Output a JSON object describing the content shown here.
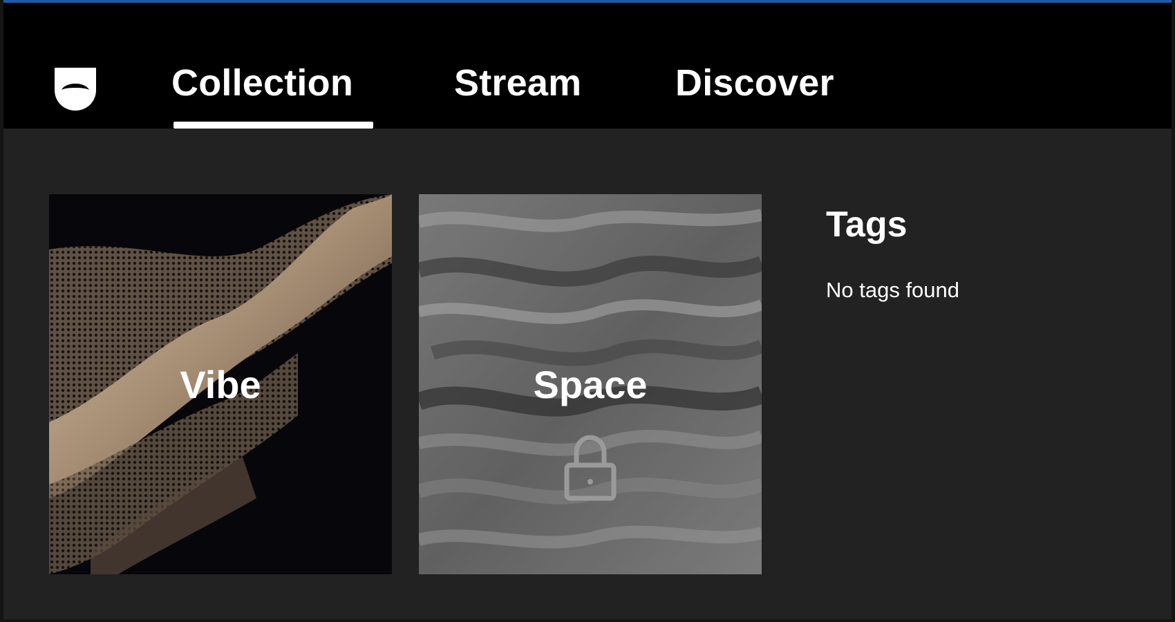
{
  "nav": {
    "logo_icon": "mask-icon",
    "tabs": [
      {
        "label": "Collection",
        "active": true
      },
      {
        "label": "Stream",
        "active": false
      },
      {
        "label": "Discover",
        "active": false
      }
    ]
  },
  "collections": [
    {
      "label": "Vibe",
      "locked": false,
      "image": "abstract-wave-artwork"
    },
    {
      "label": "Space",
      "locked": true,
      "image": "grey-fur-texture",
      "lock_icon": "lock-icon"
    }
  ],
  "tags": {
    "title": "Tags",
    "empty_message": "No tags found"
  },
  "colors": {
    "accent": "#1f5aa6",
    "topbar": "#000000",
    "background": "#222222",
    "text": "#ffffff"
  }
}
